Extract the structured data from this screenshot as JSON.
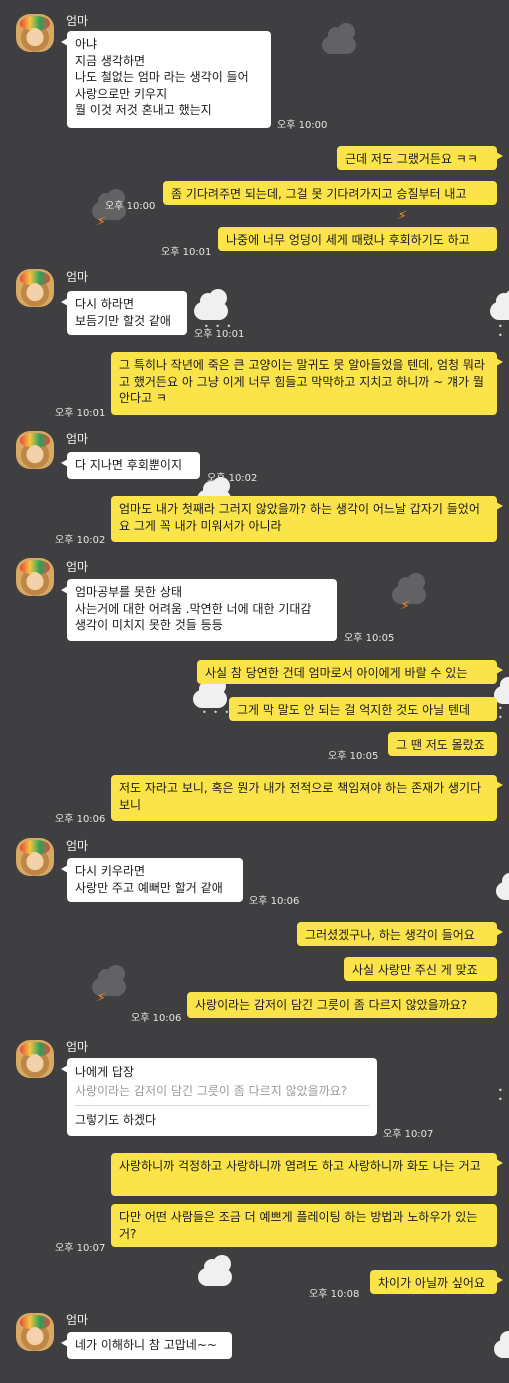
{
  "contact": {
    "name": "엄마"
  },
  "messages": [
    {
      "lines": [
        "아냐",
        "지금 생각하면",
        "나도 철없는 엄마 라는 생각이 들어",
        "사랑으로만 키우지",
        "뭘 이것 저것 혼내고  했는지"
      ],
      "time": "오후 10:00"
    },
    {
      "text": "근데 저도 그랬거든요 ㅋㅋ"
    },
    {
      "text": "좀 기다려주면 되는데, 그걸 못 기다려가지고 승질부터 내고",
      "time": "오후 10:00"
    },
    {
      "text": "나중에 너무 엉덩이 세게 때렸나 후회하기도 하고",
      "time": "오후 10:01"
    },
    {
      "lines": [
        "다시 하라면",
        "보듬기만 할것 같애"
      ],
      "time": "오후 10:01"
    },
    {
      "text": "그 특히나 작년에 죽은 큰 고양이는 말귀도 못 알아들었을 텐데, 엄청 뭐라고 했거든요 아 그냥 이게 너무 힘들고 막막하고 지치고 하니까 ~ 걔가 뭘 안다고 ㅋ",
      "time": "오후 10:01"
    },
    {
      "lines": [
        "다 지나면 후회뿐이지"
      ],
      "time": "오후 10:02"
    },
    {
      "text": "엄마도 내가 첫째라 그러지 않았을까? 하는 생각이 어느날 갑자기 들었어요 그게 꼭 내가 미워서가 아니라",
      "time": "오후 10:02"
    },
    {
      "lines": [
        "엄마공부를 못한  상태",
        "사는거에 대한 어려움 .막연한 너에 대한 기대감",
        "생각이 미치지 못한 것들 등등"
      ],
      "time": "오후 10:05"
    },
    {
      "text": "사실 참 당연한 건데 엄마로서 아이에게 바랄 수 있는"
    },
    {
      "text": "그게 막 말도 안 되는 걸 억지한 것도 아닐 텐데"
    },
    {
      "text": "그 땐 저도 몰랐죠",
      "time": "오후 10:05"
    },
    {
      "text": "저도 자라고 보니, 혹은 뭔가 내가 전적으로 책임져야 하는 존재가 생기다 보니",
      "time": "오후 10:06"
    },
    {
      "lines": [
        "다시 키우라면",
        "사랑만 주고 예뻐만 할거 같애"
      ],
      "time": "오후 10:06"
    },
    {
      "text": "그러셨겠구나, 하는 생각이 들어요"
    },
    {
      "text": "사실 사랑만 주신 게 맞죠"
    },
    {
      "text": "사랑이라는 감저이 담긴 그릇이 좀 다르지 않았을까요?",
      "time": "오후 10:06"
    },
    {
      "reply_label": "나에게 답장",
      "quote": "사랑이라는 감저이 담긴 그릇이 좀 다르지 않았을까요?",
      "text": "그렇기도 하겠다",
      "time": "오후 10:07"
    },
    {
      "text": "사랑하니까 걱정하고 사랑하니까 염려도 하고 사랑하니까 화도 나는 거고"
    },
    {
      "text": "다만 어떤 사람들은 조금 더 예쁘게 플레이팅 하는 방법과 노하우가 있는 거?",
      "time": "오후 10:07"
    },
    {
      "text": "차이가 아닐까 싶어요",
      "time": "오후 10:08"
    },
    {
      "lines": [
        "네가 이해하니 참 고맙네~~"
      ]
    }
  ],
  "icons": {
    "avatar": "avatar-icon",
    "cloud": "cloud-icon",
    "lightning": "lightning-icon",
    "moon": "moon-icon",
    "rain": "rain-icon"
  },
  "colors": {
    "background": "#3f3f41",
    "incoming": "#ffffff",
    "outgoing": "#fbe34a",
    "accent": "#e98b21"
  }
}
